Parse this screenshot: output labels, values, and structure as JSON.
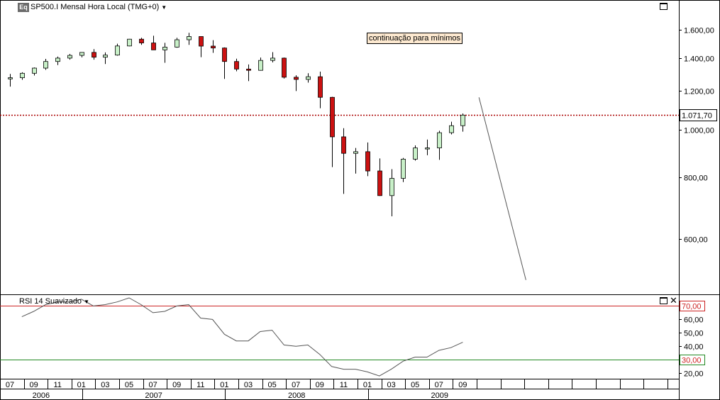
{
  "header": {
    "badge": "Eq",
    "title": "SP500.I Mensal Hora Local (TMG+0)",
    "indicator_title": "RSI 14 Suavizado"
  },
  "annotation": "continuação para mínimos",
  "colors": {
    "bull": "#c8f0c8",
    "bear": "#cc1111",
    "price_line": "#aa0000",
    "rsi_upper": "#cc2222",
    "rsi_lower": "#228822"
  },
  "chart_data": [
    {
      "type": "candlestick",
      "title": "SP500.I Mensal Hora Local (TMG+0)",
      "scale": "log",
      "ylim": [
        480,
        1720
      ],
      "y_ticks": [
        600,
        800,
        1000,
        1200,
        1400,
        1600
      ],
      "y_tick_labels": [
        "600,00",
        "800,00",
        "1.000,00",
        "1.200,00",
        "1.400,00",
        "1.600,00"
      ],
      "last_price": 1071.7,
      "last_price_label": "1.071,70",
      "x_month_labels": [
        "07",
        "09",
        "11",
        "01",
        "03",
        "05",
        "07",
        "09",
        "11",
        "01",
        "03",
        "05",
        "07",
        "09",
        "11",
        "01",
        "03",
        "05",
        "07",
        "09"
      ],
      "x_year_labels": [
        "2006",
        "2007",
        "2008",
        "2009"
      ],
      "candles": [
        {
          "month": "2006-07",
          "open": 1270,
          "high": 1300,
          "low": 1225,
          "close": 1277
        },
        {
          "month": "2006-08",
          "open": 1277,
          "high": 1310,
          "low": 1265,
          "close": 1304
        },
        {
          "month": "2006-09",
          "open": 1304,
          "high": 1340,
          "low": 1290,
          "close": 1336
        },
        {
          "month": "2006-10",
          "open": 1336,
          "high": 1395,
          "low": 1325,
          "close": 1378
        },
        {
          "month": "2006-11",
          "open": 1378,
          "high": 1410,
          "low": 1355,
          "close": 1400
        },
        {
          "month": "2006-12",
          "open": 1400,
          "high": 1428,
          "low": 1390,
          "close": 1418
        },
        {
          "month": "2007-01",
          "open": 1418,
          "high": 1440,
          "low": 1405,
          "close": 1438
        },
        {
          "month": "2007-02",
          "open": 1438,
          "high": 1460,
          "low": 1390,
          "close": 1406
        },
        {
          "month": "2007-03",
          "open": 1406,
          "high": 1438,
          "low": 1362,
          "close": 1420
        },
        {
          "month": "2007-04",
          "open": 1420,
          "high": 1498,
          "low": 1416,
          "close": 1482
        },
        {
          "month": "2007-05",
          "open": 1482,
          "high": 1532,
          "low": 1480,
          "close": 1530
        },
        {
          "month": "2007-06",
          "open": 1530,
          "high": 1540,
          "low": 1490,
          "close": 1503
        },
        {
          "month": "2007-07",
          "open": 1503,
          "high": 1555,
          "low": 1460,
          "close": 1455
        },
        {
          "month": "2007-08",
          "open": 1455,
          "high": 1504,
          "low": 1370,
          "close": 1474
        },
        {
          "month": "2007-09",
          "open": 1474,
          "high": 1540,
          "low": 1470,
          "close": 1526
        },
        {
          "month": "2007-10",
          "open": 1526,
          "high": 1576,
          "low": 1490,
          "close": 1549
        },
        {
          "month": "2007-11",
          "open": 1549,
          "high": 1545,
          "low": 1406,
          "close": 1481
        },
        {
          "month": "2007-12",
          "open": 1481,
          "high": 1523,
          "low": 1435,
          "close": 1468
        },
        {
          "month": "2008-01",
          "open": 1468,
          "high": 1472,
          "low": 1270,
          "close": 1378
        },
        {
          "month": "2008-02",
          "open": 1378,
          "high": 1396,
          "low": 1316,
          "close": 1330
        },
        {
          "month": "2008-03",
          "open": 1330,
          "high": 1359,
          "low": 1257,
          "close": 1322
        },
        {
          "month": "2008-04",
          "open": 1322,
          "high": 1404,
          "low": 1320,
          "close": 1385
        },
        {
          "month": "2008-05",
          "open": 1385,
          "high": 1440,
          "low": 1372,
          "close": 1400
        },
        {
          "month": "2008-06",
          "open": 1400,
          "high": 1404,
          "low": 1272,
          "close": 1280
        },
        {
          "month": "2008-07",
          "open": 1280,
          "high": 1292,
          "low": 1200,
          "close": 1267
        },
        {
          "month": "2008-08",
          "open": 1267,
          "high": 1304,
          "low": 1248,
          "close": 1283
        },
        {
          "month": "2008-09",
          "open": 1283,
          "high": 1314,
          "low": 1107,
          "close": 1165
        },
        {
          "month": "2008-10",
          "open": 1165,
          "high": 1168,
          "low": 840,
          "close": 968
        },
        {
          "month": "2008-11",
          "open": 968,
          "high": 1008,
          "low": 741,
          "close": 896
        },
        {
          "month": "2008-12",
          "open": 896,
          "high": 919,
          "low": 815,
          "close": 903
        },
        {
          "month": "2009-01",
          "open": 903,
          "high": 943,
          "low": 805,
          "close": 825
        },
        {
          "month": "2009-02",
          "open": 825,
          "high": 875,
          "low": 734,
          "close": 735
        },
        {
          "month": "2009-03",
          "open": 735,
          "high": 832,
          "low": 667,
          "close": 797
        },
        {
          "month": "2009-04",
          "open": 797,
          "high": 877,
          "low": 783,
          "close": 872
        },
        {
          "month": "2009-05",
          "open": 872,
          "high": 930,
          "low": 866,
          "close": 919
        },
        {
          "month": "2009-06",
          "open": 919,
          "high": 956,
          "low": 888,
          "close": 919
        },
        {
          "month": "2009-07",
          "open": 919,
          "high": 996,
          "low": 869,
          "close": 987
        },
        {
          "month": "2009-08",
          "open": 987,
          "high": 1039,
          "low": 979,
          "close": 1020
        },
        {
          "month": "2009-09",
          "open": 1020,
          "high": 1080,
          "low": 992,
          "close": 1071.7
        }
      ],
      "trendline": [
        {
          "month": "2009-10",
          "value": 1165
        },
        {
          "month": "2010-02",
          "value": 495
        }
      ]
    },
    {
      "type": "line",
      "title": "RSI 14 Suavizado",
      "ylim": [
        17,
        76
      ],
      "y_ticks": [
        20,
        30,
        40,
        50,
        60,
        70
      ],
      "y_tick_labels": [
        "20,00",
        "30,00",
        "40,00",
        "50,00",
        "60,00",
        "70,00"
      ],
      "levels": [
        70,
        30
      ],
      "series": [
        {
          "values": [
            62,
            66,
            71,
            73,
            73,
            75,
            70,
            71,
            73,
            76,
            71,
            65,
            66,
            70,
            71,
            61,
            60,
            49,
            44,
            44,
            51,
            52,
            41,
            40,
            41,
            34,
            25,
            23,
            23,
            21,
            18,
            23,
            29,
            32,
            32,
            37,
            39,
            43
          ]
        }
      ]
    }
  ]
}
